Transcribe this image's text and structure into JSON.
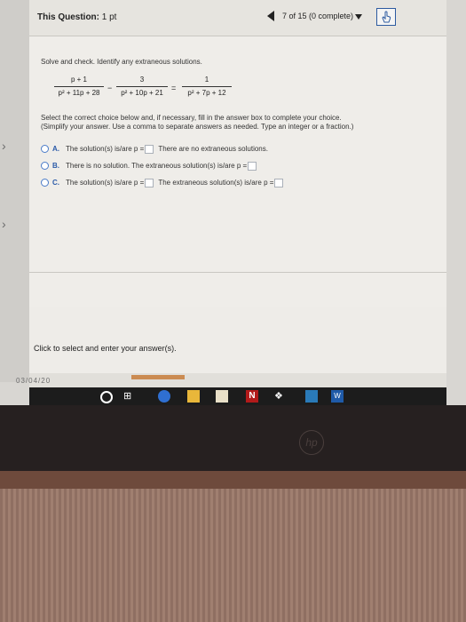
{
  "header": {
    "question_label": "This Question:",
    "points": "1 pt",
    "progress": "7 of 15 (0 complete)"
  },
  "problem": {
    "instruction": "Solve and check. Identify any extraneous solutions.",
    "equation": {
      "frac1_num": "p + 1",
      "frac1_den": "p² + 11p + 28",
      "op1": "−",
      "frac2_num": "3",
      "frac2_den": "p² + 10p + 21",
      "op2": "=",
      "frac3_num": "1",
      "frac3_den": "p² + 7p + 12"
    },
    "select_line1": "Select the correct choice below and, if necessary, fill in the answer box to complete your choice.",
    "select_line2": "(Simplify your answer. Use a comma to separate answers as needed. Type an integer or a fraction.)"
  },
  "choices": [
    {
      "letter": "A.",
      "part1": "The solution(s) is/are p =",
      "part2": "There are no extraneous solutions."
    },
    {
      "letter": "B.",
      "part1": "There is no solution. The extraneous solution(s) is/are p =",
      "part2": ""
    },
    {
      "letter": "C.",
      "part1": "The solution(s) is/are p =",
      "part2": "The extraneous solution(s) is/are p ="
    }
  ],
  "footer": {
    "instruction": "Click to select and enter your answer(s).",
    "date_ghost": "03/04/20"
  },
  "taskbar": {
    "netflix": "N",
    "word": "W"
  },
  "brand": "hp"
}
